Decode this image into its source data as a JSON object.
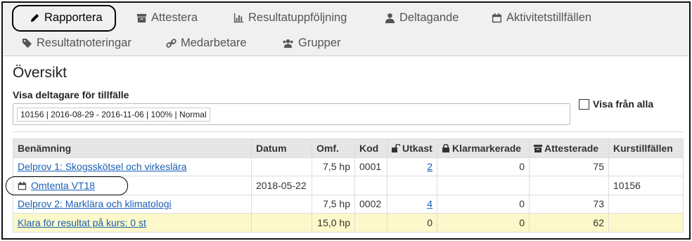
{
  "tabs": [
    {
      "label": "Rapportera",
      "icon": "pencil-icon"
    },
    {
      "label": "Attestera",
      "icon": "archive-icon"
    },
    {
      "label": "Resultatuppföljning",
      "icon": "bar-chart-icon"
    },
    {
      "label": "Deltagande",
      "icon": "user-icon"
    },
    {
      "label": "Aktivitetstillfällen",
      "icon": "calendar-icon"
    },
    {
      "label": "Resultatnoteringar",
      "icon": "tag-icon"
    },
    {
      "label": "Medarbetare",
      "icon": "link-icon"
    },
    {
      "label": "Grupper",
      "icon": "users-icon"
    }
  ],
  "active_tab": "Rapportera",
  "panel": {
    "title": "Översikt",
    "filter_label": "Visa deltagare för tillfälle",
    "filter_value": "10156 | 2016-08-29 - 2016-11-06 | 100% | Normal",
    "show_all_label": "Visa från alla",
    "show_all_checked": false
  },
  "table": {
    "headers": [
      "Benämning",
      "Datum",
      "Omf.",
      "Kod",
      "Utkast",
      "Klarmarkerade",
      "Attesterade",
      "Kurstillfällen"
    ],
    "rows": [
      {
        "name": "Delprov 1: Skogsskötsel och virkeslära",
        "datum": "",
        "omf": "7,5 hp",
        "kod": "0001",
        "utkast": "2",
        "klar": "0",
        "attest": "75",
        "kurs": ""
      },
      {
        "name": "Omtenta VT18",
        "datum": "2018-05-22",
        "omf": "",
        "kod": "",
        "utkast": "",
        "klar": "",
        "attest": "",
        "kurs": "10156"
      },
      {
        "name": "Delprov 2: Marklära och klimatologi",
        "datum": "",
        "omf": "7,5 hp",
        "kod": "0002",
        "utkast": "4",
        "klar": "0",
        "attest": "73",
        "kurs": ""
      }
    ],
    "summary": {
      "name": "Klara för resultat på kurs: 0 st",
      "datum": "",
      "omf": "15,0 hp",
      "kod": "",
      "utkast": "0",
      "klar": "0",
      "attest": "62",
      "kurs": ""
    }
  },
  "colors": {
    "link": "#1a5fb4",
    "summary_bg": "#fcf8c9",
    "header_bg": "#e6e6e6",
    "tabbar_bg": "#f0f0f0"
  }
}
